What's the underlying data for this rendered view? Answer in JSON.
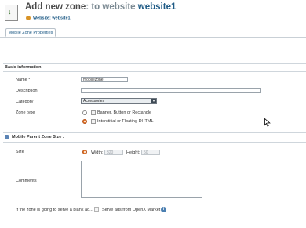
{
  "header": {
    "title_prefix": "Add new zone",
    "title_middle": ": to website",
    "title_website": "website1",
    "crumb_label": "Website:",
    "crumb_value": "website1"
  },
  "tabs": [
    {
      "label": "Mobile Zone Properties"
    }
  ],
  "basic": {
    "section_title": "Basic information",
    "name_label": "Name *",
    "name_value": "mobilezone",
    "description_label": "Description",
    "description_value": "",
    "category_label": "Category",
    "category_value": "Accessories",
    "zone_type_label": "Zone type",
    "zone_type_options": [
      {
        "label": "Banner, Button or Rectangle",
        "selected": false,
        "icon": "banner-icon"
      },
      {
        "label": "Interstitial or Floating DHTML",
        "selected": true,
        "icon": "interstitial-icon"
      }
    ]
  },
  "mobile": {
    "section_title": "Mobile Parent Zone Size :",
    "size_label": "Size",
    "width_label": "Width:",
    "width_value": "320",
    "height_label": "Height:",
    "height_value": "50",
    "comments_label": "Comments",
    "comments_value": "",
    "blank_ad_label": "If the zone is going to serve a blank ad...",
    "openx_label": "Serve ads from OpenX Market",
    "openx_checked": false
  },
  "colors": {
    "link": "#1f5b86",
    "radio_selected": "#e37a2f"
  }
}
